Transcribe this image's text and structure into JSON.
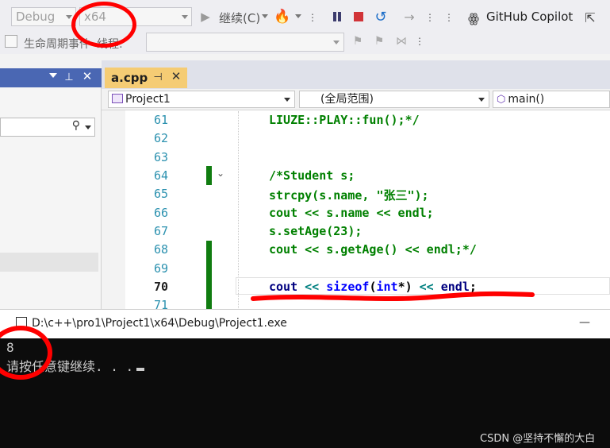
{
  "toolbar": {
    "config": "Debug",
    "platform": "x64",
    "continue_label": "继续(C)",
    "copilot_label": "GitHub Copilot",
    "lifecycle_label": "生命周期事件",
    "thread_label": "线程:",
    "thread_value": ""
  },
  "tabs": [
    {
      "label": "a.cpp",
      "active": true
    }
  ],
  "navbar": {
    "project": "Project1",
    "scope": "(全局范围)",
    "member": "main()"
  },
  "editor": {
    "lines": [
      {
        "num": "61",
        "text": "LIUZE::PLAY::fun();*/"
      },
      {
        "num": "62",
        "text": ""
      },
      {
        "num": "63",
        "text": ""
      },
      {
        "num": "64",
        "text": "/*Student s;"
      },
      {
        "num": "65",
        "text": "strcpy(s.name, \"张三\");"
      },
      {
        "num": "66",
        "text": "cout << s.name << endl;"
      },
      {
        "num": "67",
        "text": "s.setAge(23);"
      },
      {
        "num": "68",
        "text": "cout << s.getAge() << endl;*/"
      },
      {
        "num": "69",
        "text": ""
      },
      {
        "num": "70",
        "text": "cout << sizeof(int*) << endl;"
      },
      {
        "num": "71",
        "text": ""
      }
    ],
    "current_line": "70"
  },
  "console": {
    "title": "D:\\c++\\pro1\\Project1\\x64\\Debug\\Project1.exe",
    "output_line1": "8",
    "output_line2": "请按任意键继续. . .",
    "minimize_label": "—"
  },
  "watermark": "CSDN @坚持不懈的大白",
  "colors": {
    "accent_tab": "#f5cc74",
    "panel_header": "#4a67b3",
    "annotation": "#ff0000",
    "comment_green": "#008000",
    "keyword_blue": "#0000ff"
  }
}
